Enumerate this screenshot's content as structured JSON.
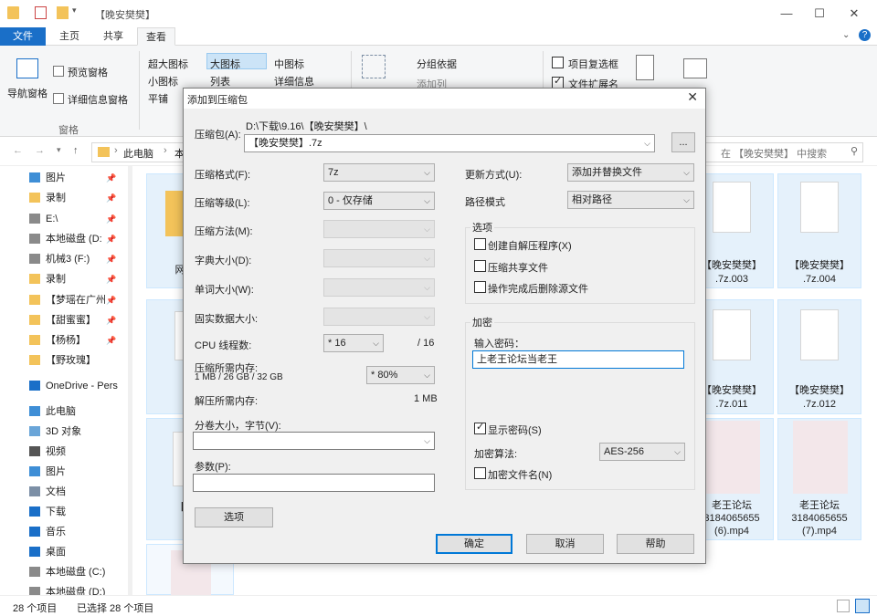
{
  "explorer": {
    "title": "【晚安樊樊】",
    "ribbon_tabs": [
      "文件",
      "主页",
      "共享",
      "查看"
    ],
    "ribbon": {
      "nav_pane": "导航窗格",
      "preview_pane": "预览窗格",
      "details_pane": "详细信息窗格",
      "panes_group": "窗格",
      "xl_icons": "超大图标",
      "large_icons": "大图标",
      "medium_icons": "中图标",
      "small_icons": "小图标",
      "list": "列表",
      "details": "详细信息",
      "tiles": "平铺",
      "group_by": "分组依据",
      "add_column": "添加列",
      "item_checkboxes": "项目复选框",
      "file_extensions": "文件扩展名"
    },
    "address": {
      "crumbs": [
        "此电脑",
        "本"
      ]
    },
    "search_placeholder": "在 【晚安樊樊】 中搜索",
    "sidebar": [
      {
        "label": "图片",
        "icon": "picture-icon",
        "pinned": true
      },
      {
        "label": "录制",
        "icon": "folder-icon",
        "pinned": true
      },
      {
        "label": "E:\\",
        "icon": "drive-icon",
        "pinned": true
      },
      {
        "label": "本地磁盘 (D:",
        "icon": "drive-icon",
        "pinned": true
      },
      {
        "label": "机械3 (F:)",
        "icon": "drive-icon",
        "pinned": true
      },
      {
        "label": "录制",
        "icon": "folder-icon",
        "pinned": true
      },
      {
        "label": "【梦瑶在广州",
        "icon": "folder-icon",
        "pinned": true
      },
      {
        "label": "【甜蜜蜜】",
        "icon": "folder-icon",
        "pinned": true
      },
      {
        "label": "【杨杨】",
        "icon": "folder-icon",
        "pinned": true
      },
      {
        "label": "【野玫瑰】",
        "icon": "folder-icon",
        "pinned": false
      },
      {
        "label": "OneDrive - Pers",
        "icon": "onedrive-icon",
        "pinned": false
      },
      {
        "label": "此电脑",
        "icon": "computer-icon",
        "pinned": false
      },
      {
        "label": "3D 对象",
        "icon": "cube-icon",
        "pinned": false
      },
      {
        "label": "视频",
        "icon": "video-icon",
        "pinned": false
      },
      {
        "label": "图片",
        "icon": "picture-icon",
        "pinned": false
      },
      {
        "label": "文档",
        "icon": "document-icon",
        "pinned": false
      },
      {
        "label": "下载",
        "icon": "download-icon",
        "pinned": false
      },
      {
        "label": "音乐",
        "icon": "music-icon",
        "pinned": false
      },
      {
        "label": "桌面",
        "icon": "desktop-icon",
        "pinned": false
      },
      {
        "label": "本地磁盘 (C:)",
        "icon": "drive-icon",
        "pinned": false
      },
      {
        "label": "本地磁盘 (D:)",
        "icon": "drive-icon",
        "pinned": false
      }
    ],
    "files": {
      "row1_left_label": "网速最",
      "f003_a": "【晚安樊樊】",
      "f003_b": ".7z.003",
      "f004_a": "【晚安樊樊】",
      "f004_b": ".7z.004",
      "row2_left_a": "【晚",
      "row2_left_b": ".7",
      "f011_a": "【晚安樊樊】",
      "f011_b": ".7z.011",
      "f012_a": "【晚安樊樊】",
      "f012_b": ".7z.012",
      "row3_left_a": "【永久",
      "row3_left_b": "页",
      "v6_a": "老王论坛",
      "v6_b": "3184065655",
      "v6_c": "(6).mp4",
      "v7_a": "老王论坛",
      "v7_b": "3184065655",
      "v7_c": "(7).mp4"
    },
    "status": {
      "count": "28 个项目",
      "selected": "已选择 28 个项目"
    }
  },
  "dialog": {
    "title": "添加到压缩包",
    "close": "✕",
    "archive_label": "压缩包(A):",
    "archive_path": "D:\\下载\\9.16\\【晚安樊樊】\\",
    "archive_name": "【晚安樊樊】.7z",
    "browse": "...",
    "format_label": "压缩格式(F):",
    "format_value": "7z",
    "level_label": "压缩等级(L):",
    "level_value": "0 - 仅存储",
    "method_label": "压缩方法(M):",
    "dict_label": "字典大小(D):",
    "word_label": "单词大小(W):",
    "solid_label": "固实数据大小:",
    "threads_label": "CPU 线程数:",
    "threads_value": "* 16",
    "threads_total": "/ 16",
    "mem_comp_label": "压缩所需内存:",
    "mem_comp_value": "1 MB / 26 GB / 32 GB",
    "mem_percent": "* 80%",
    "mem_decomp_label": "解压所需内存:",
    "mem_decomp_value": "1 MB",
    "split_label": "分卷大小，字节(V):",
    "params_label": "参数(P):",
    "options_btn": "选项",
    "update_label": "更新方式(U):",
    "update_value": "添加并替换文件",
    "path_label": "路径模式",
    "path_value": "相对路径",
    "options_group": "选项",
    "opt_sfx": "创建自解压程序(X)",
    "opt_shared": "压缩共享文件",
    "opt_delete": "操作完成后删除源文件",
    "encrypt_group": "加密",
    "password_label": "输入密码：",
    "password_value": "上老王论坛当老王",
    "show_password": "显示密码(S)",
    "enc_method_label": "加密算法:",
    "enc_method_value": "AES-256",
    "encrypt_names": "加密文件名(N)",
    "ok": "确定",
    "cancel": "取消",
    "help": "帮助"
  }
}
